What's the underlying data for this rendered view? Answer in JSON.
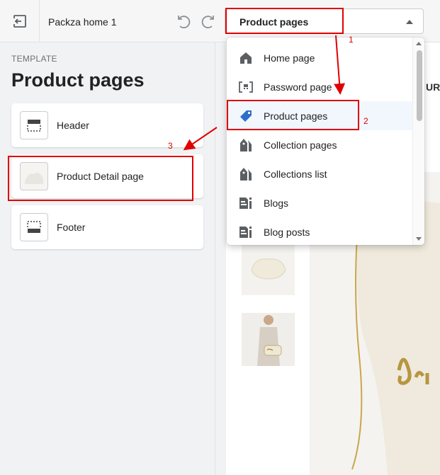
{
  "topbar": {
    "theme_name": "Packza home 1",
    "template_selector_value": "Product pages"
  },
  "sidebar": {
    "section_heading": "TEMPLATE",
    "title": "Product pages",
    "sections": [
      {
        "label": "Header",
        "icon": "header-section-icon"
      },
      {
        "label": "Product Detail page",
        "icon": "product-image-thumbnail"
      },
      {
        "label": "Footer",
        "icon": "footer-section-icon"
      }
    ]
  },
  "dropdown": {
    "items": [
      {
        "label": "Home page",
        "icon": "home-icon"
      },
      {
        "label": "Password page",
        "icon": "password-icon"
      },
      {
        "label": "Product pages",
        "icon": "product-tag-icon",
        "selected": true
      },
      {
        "label": "Collection pages",
        "icon": "collection-icon"
      },
      {
        "label": "Collections list",
        "icon": "collections-list-icon"
      },
      {
        "label": "Blogs",
        "icon": "blog-icon"
      },
      {
        "label": "Blog posts",
        "icon": "blog-post-icon"
      }
    ]
  },
  "preview": {
    "partial_heading": "URE"
  },
  "annotations": {
    "step_1": "1",
    "step_2": "2",
    "step_3": "3",
    "highlight_color": "#e00000"
  },
  "colors": {
    "selected_bg": "#f2f7fe",
    "tag_icon": "#2c6ecb"
  }
}
